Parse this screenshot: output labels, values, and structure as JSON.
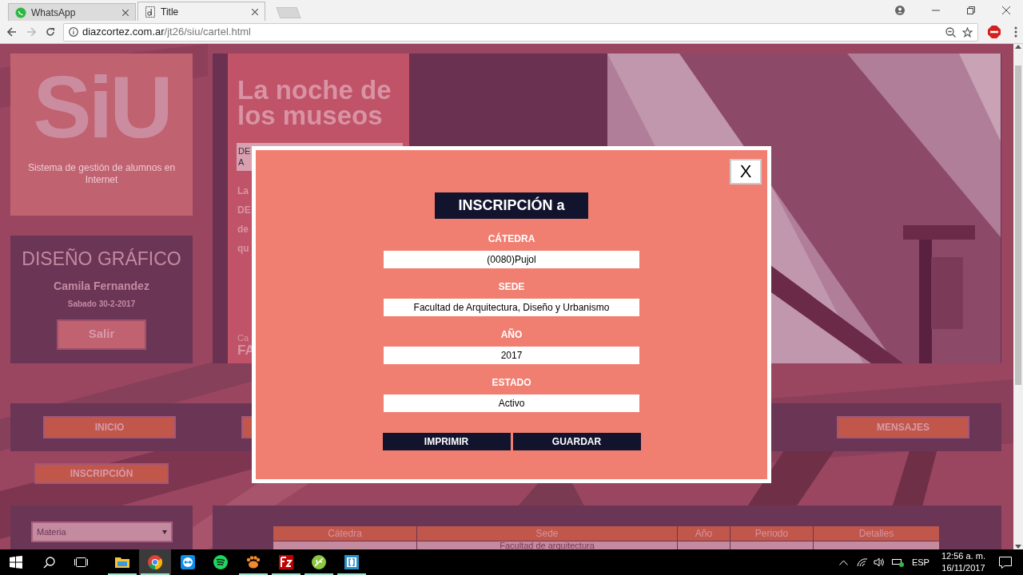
{
  "browser": {
    "tabs": [
      {
        "title": "WhatsApp",
        "kind": "chat",
        "selected": false
      },
      {
        "title": "Title",
        "kind": "doc",
        "selected": true
      }
    ],
    "url": {
      "host": "diazcortez.com.ar",
      "path": "/jt26/siu/cartel.html"
    }
  },
  "sidebar": {
    "logo": "SiU",
    "tagline": "Sistema de gestión de alumnos en Internet",
    "career": "DISEÑO GRÁFICO",
    "student": "Camila Fernandez",
    "date": "Sabado 30-2-2017",
    "logout": "Salir",
    "filter": {
      "value": "Materia"
    }
  },
  "banner": {
    "title_lines": [
      "La noche de",
      "los museos"
    ],
    "notice_lines": [
      "DE",
      "A"
    ],
    "paragraph_lines": [
      "La",
      "DE",
      "de",
      "qu"
    ],
    "footer_lines": [
      "Ca",
      "FA"
    ]
  },
  "nav": {
    "items": [
      "INICIO",
      "MENSAJES"
    ]
  },
  "subnav": {
    "items": [
      "INSCRIPCIÓN"
    ]
  },
  "table": {
    "columns": [
      "Cátedra",
      "Sede",
      "Año",
      "Periodo",
      "Detalles"
    ],
    "rows": [
      [
        "",
        "Facultad de arquitectura",
        "",
        "",
        ""
      ]
    ]
  },
  "modal": {
    "title": "INSCRIPCIÓN a",
    "close": "X",
    "fields": [
      {
        "label": "CÁTEDRA",
        "value": "(0080)Pujol"
      },
      {
        "label": "SEDE",
        "value": "Facultad de Arquitectura, Diseño y Urbanismo"
      },
      {
        "label": "AÑO",
        "value": "2017"
      },
      {
        "label": "ESTADO",
        "value": "Activo"
      }
    ],
    "buttons": [
      "IMPRIMIR",
      "GUARDAR"
    ]
  },
  "taskbar": {
    "apps": [
      {
        "kind": "folder",
        "running": true,
        "selected": false
      },
      {
        "kind": "chrome",
        "running": true,
        "selected": true
      },
      {
        "kind": "remote",
        "running": false,
        "selected": false
      },
      {
        "kind": "music",
        "running": false,
        "selected": false
      },
      {
        "kind": "paw",
        "running": true,
        "selected": false
      },
      {
        "kind": "ftp",
        "running": true,
        "selected": false
      },
      {
        "kind": "leaf",
        "running": true,
        "selected": false
      },
      {
        "kind": "bracket",
        "running": true,
        "selected": false
      }
    ],
    "language": "ESP",
    "time": "12:56 a. m.",
    "date": "16/11/2017"
  }
}
